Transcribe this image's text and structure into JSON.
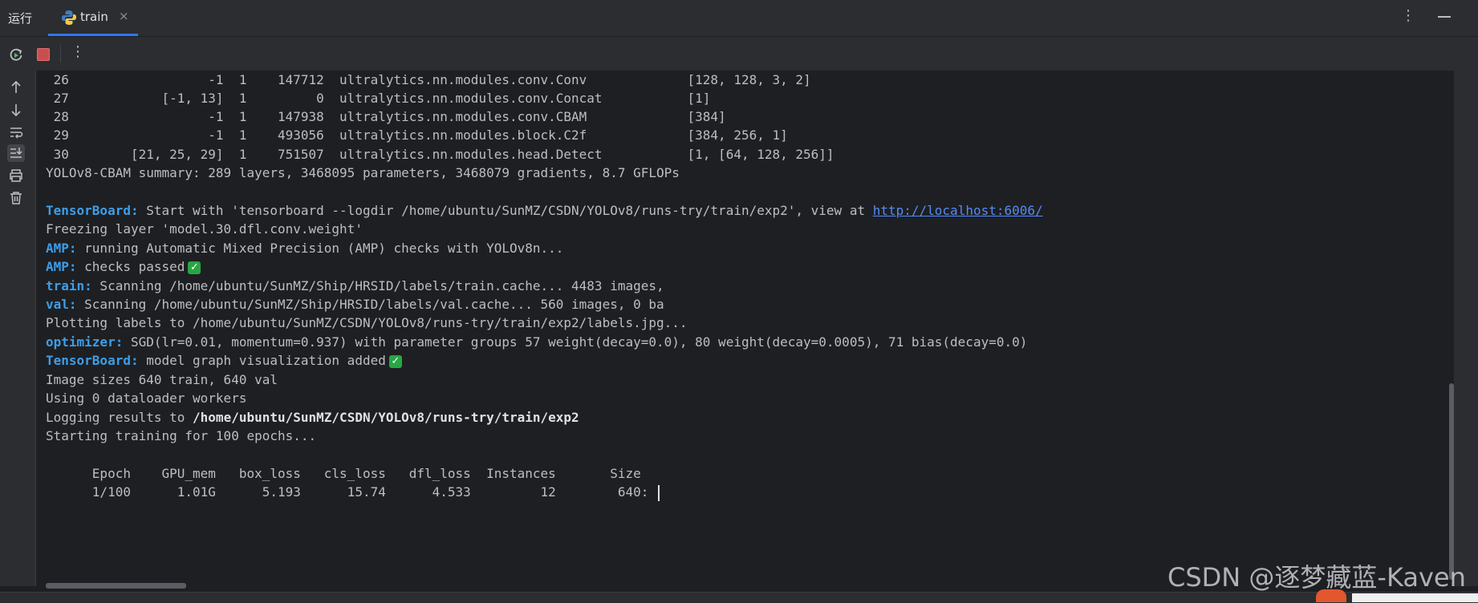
{
  "tabbar": {
    "run_label": "运行",
    "tab_label": "train",
    "tab_close": "×",
    "more": "⋮"
  },
  "toolbar": {
    "more": "⋮"
  },
  "console": {
    "layer_rows": [
      " 26                  -1  1    147712  ultralytics.nn.modules.conv.Conv             [128, 128, 3, 2]",
      " 27            [-1, 13]  1         0  ultralytics.nn.modules.conv.Concat           [1]",
      " 28                  -1  1    147938  ultralytics.nn.modules.conv.CBAM             [384]",
      " 29                  -1  1    493056  ultralytics.nn.modules.block.C2f             [384, 256, 1]",
      " 30        [21, 25, 29]  1    751507  ultralytics.nn.modules.head.Detect           [1, [64, 128, 256]]"
    ],
    "summary": "YOLOv8-CBAM summary: 289 layers, 3468095 parameters, 3468079 gradients, 8.7 GFLOPs",
    "tb_prefix": "TensorBoard:",
    "tb_text": " Start with 'tensorboard --logdir /home/ubuntu/SunMZ/CSDN/YOLOv8/runs-try/train/exp2', view at ",
    "tb_link": "http://localhost:6006/",
    "freezing": "Freezing layer 'model.30.dfl.conv.weight'",
    "amp_prefix": "AMP:",
    "amp_text1": " running Automatic Mixed Precision (AMP) checks with YOLOv8n...",
    "amp_text2": " checks passed",
    "train_prefix": "train:",
    "train_text": " Scanning /home/ubuntu/SunMZ/Ship/HRSID/labels/train.cache... 4483 images,",
    "val_prefix": "val:",
    "val_text": " Scanning /home/ubuntu/SunMZ/Ship/HRSID/labels/val.cache... 560 images, 0 ba",
    "plotting": "Plotting labels to /home/ubuntu/SunMZ/CSDN/YOLOv8/runs-try/train/exp2/labels.jpg...",
    "opt_prefix": "optimizer:",
    "opt_text": " SGD(lr=0.01, momentum=0.937) with parameter groups 57 weight(decay=0.0), 80 weight(decay=0.0005), 71 bias(decay=0.0)",
    "tb2_prefix": "TensorBoard:",
    "tb2_text": " model graph visualization added",
    "image_sizes": "Image sizes 640 train, 640 val",
    "workers": "Using 0 dataloader workers",
    "logging_prefix": "Logging results to ",
    "logging_path": "/home/ubuntu/SunMZ/CSDN/YOLOv8/runs-try/train/exp2",
    "starting": "Starting training for 100 epochs...",
    "header_row": "      Epoch    GPU_mem   box_loss   cls_loss   dfl_loss  Instances       Size",
    "epoch_row": "      1/100      1.01G      5.193      15.74      4.533         12        640:",
    "check": "✓"
  },
  "watermark": "CSDN @逐梦藏蓝-Kaven"
}
